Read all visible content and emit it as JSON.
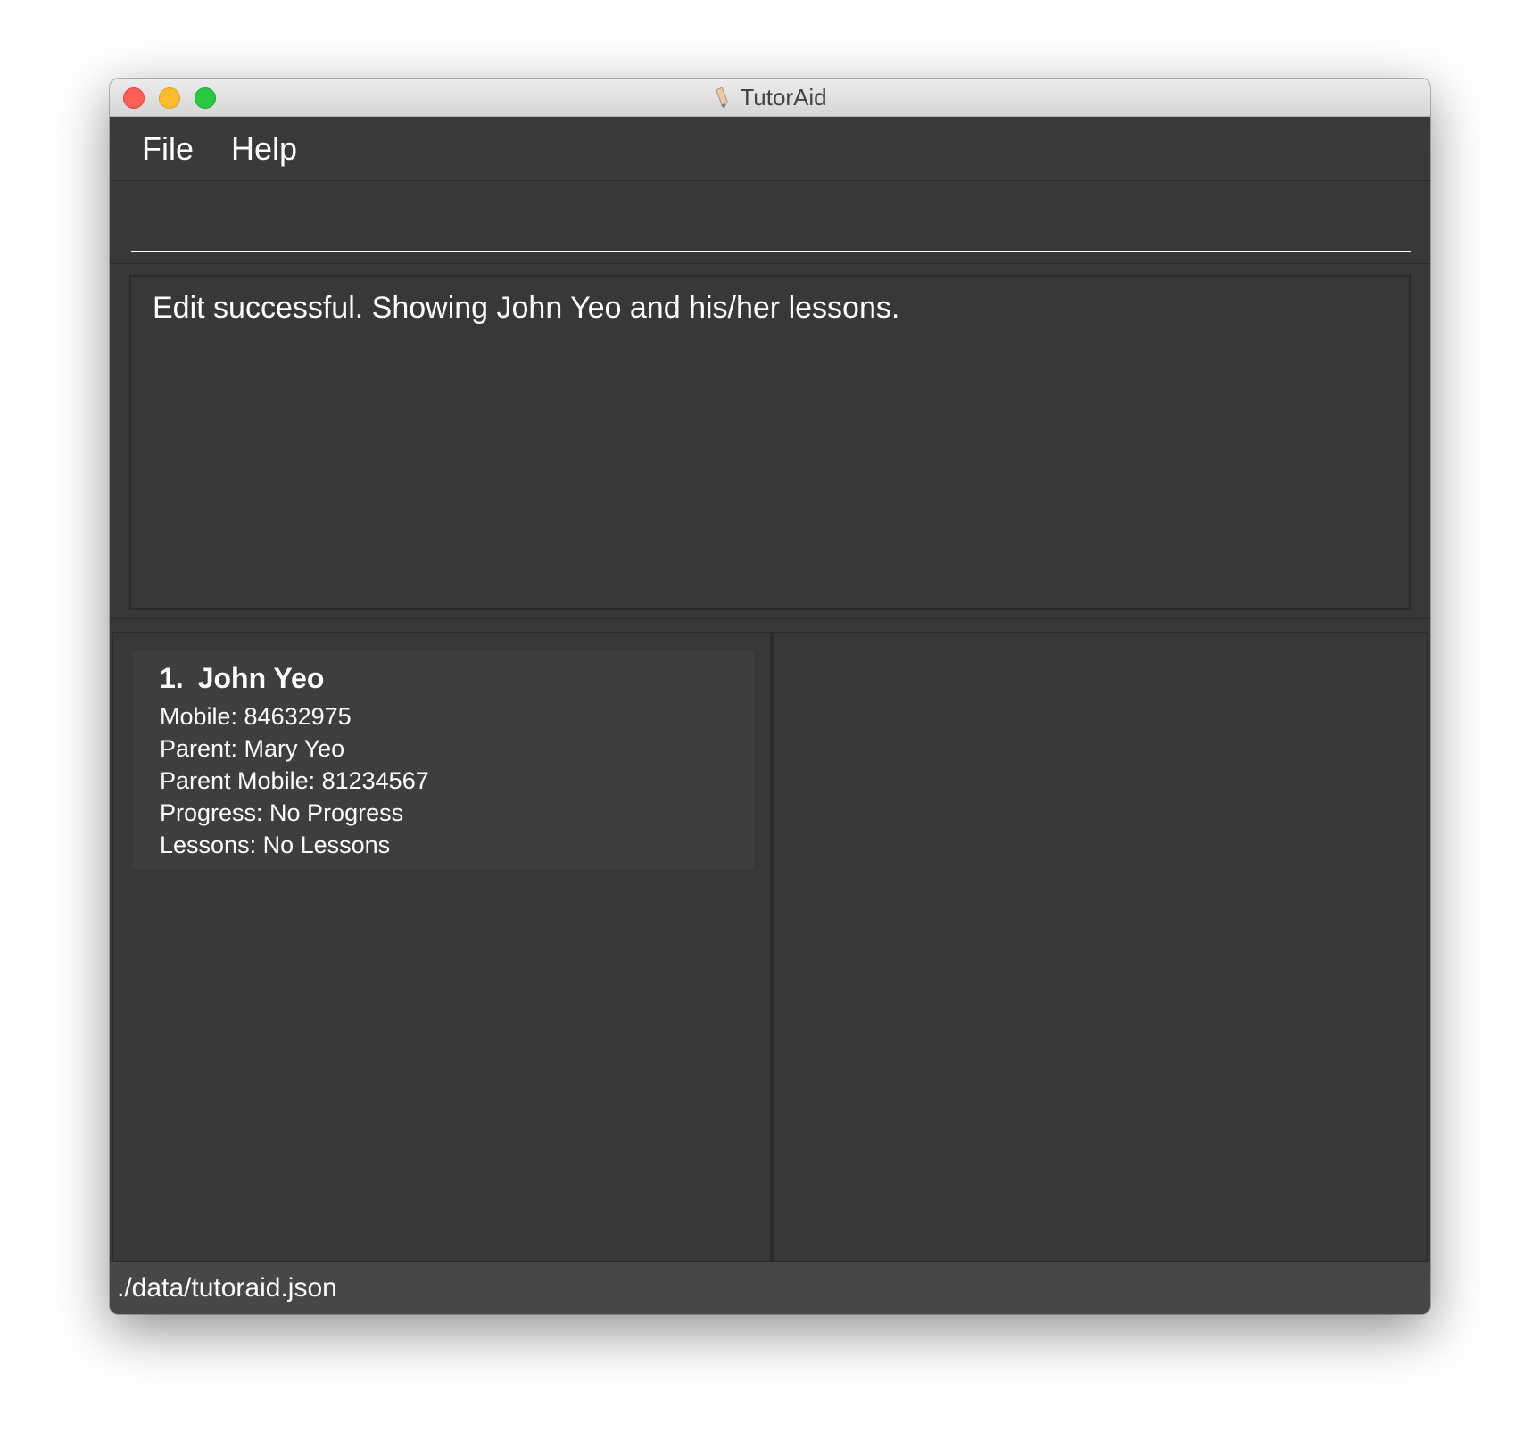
{
  "window": {
    "title": "TutorAid",
    "app_icon": "pencil-icon"
  },
  "menu": {
    "items": [
      "File",
      "Help"
    ]
  },
  "command_box": {
    "value": "",
    "placeholder": ""
  },
  "result_display": {
    "text": "Edit successful. Showing John Yeo and his/her lessons."
  },
  "student_list": {
    "students": [
      {
        "index": "1.",
        "name": "John Yeo",
        "mobile": "Mobile: 84632975",
        "parent": "Parent: Mary Yeo",
        "parent_mobile": "Parent Mobile: 81234567",
        "progress": "Progress: No Progress",
        "lessons": "Lessons: No Lessons"
      }
    ]
  },
  "status_bar": {
    "path": "./data/tutoraid.json"
  },
  "colors": {
    "background": "#383838",
    "card": "#3c3e3f",
    "status_bar": "#474747",
    "text": "#ffffff"
  }
}
